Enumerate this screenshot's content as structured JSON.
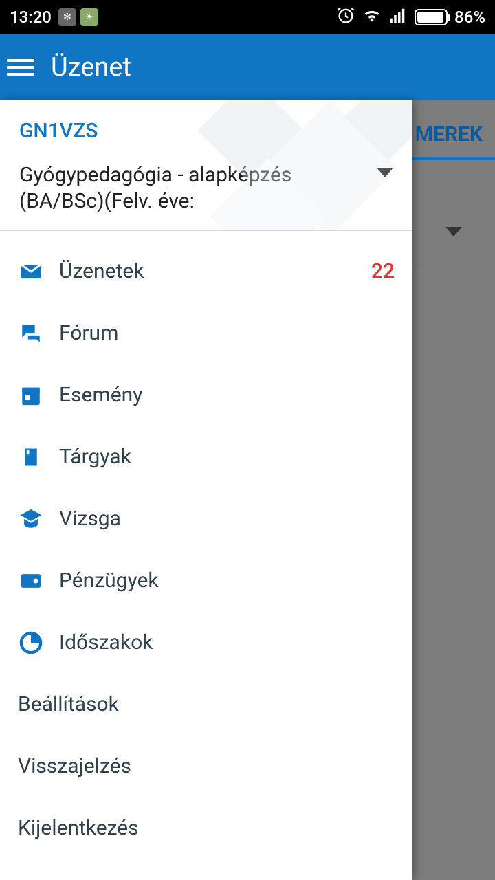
{
  "status": {
    "time": "13:20",
    "battery": "86%"
  },
  "appbar": {
    "title": "Üzenet"
  },
  "background": {
    "tab_partial": "MEREK"
  },
  "drawer": {
    "user_code": "GN1VZS",
    "program": "Gyógypedagógia - alapképzés (BA/BSc)(Felv. éve:",
    "menu": [
      {
        "label": "Üzenetek",
        "badge": "22"
      },
      {
        "label": "Fórum"
      },
      {
        "label": "Esemény"
      },
      {
        "label": "Tárgyak"
      },
      {
        "label": "Vizsga"
      },
      {
        "label": "Pénzügyek"
      },
      {
        "label": "Időszakok"
      }
    ],
    "secondary": [
      {
        "label": "Beállítások"
      },
      {
        "label": "Visszajelzés"
      },
      {
        "label": "Kijelentkezés"
      }
    ]
  }
}
